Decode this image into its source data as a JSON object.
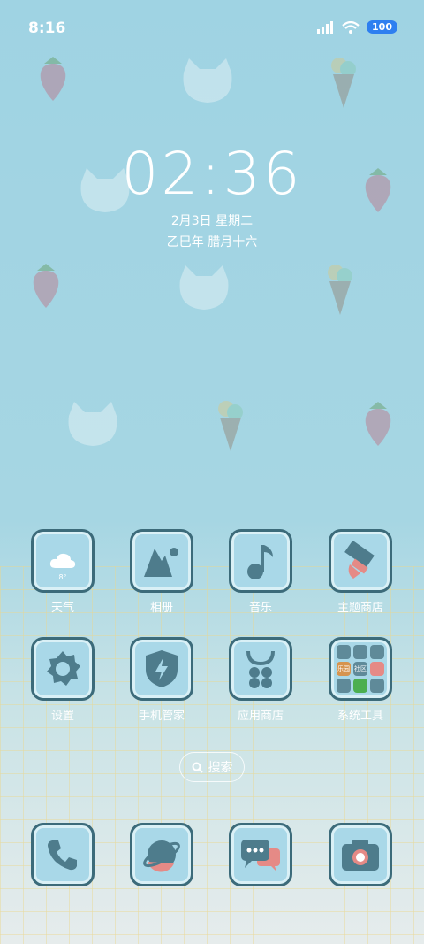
{
  "status_bar": {
    "time": "8:16",
    "battery": "100"
  },
  "lockclock": {
    "time": "02:36",
    "date": "2月3日 星期二",
    "lunar": "乙巳年 腊月十六"
  },
  "apps_row1": [
    {
      "label": "天气",
      "temp": "8°"
    },
    {
      "label": "相册"
    },
    {
      "label": "音乐"
    },
    {
      "label": "主题商店"
    }
  ],
  "apps_row2": [
    {
      "label": "设置"
    },
    {
      "label": "手机管家"
    },
    {
      "label": "应用商店"
    },
    {
      "label": "系统工具",
      "folder_mini": [
        "",
        "",
        "",
        "乐园",
        "社区",
        "",
        "",
        "",
        ""
      ]
    }
  ],
  "search": {
    "label": "搜索"
  },
  "colors": {
    "tile_bg": "#a9d8e8",
    "tile_border": "#3c6b7a",
    "icon_dark": "#4e7c8c",
    "accent_pink": "#e58a86"
  }
}
